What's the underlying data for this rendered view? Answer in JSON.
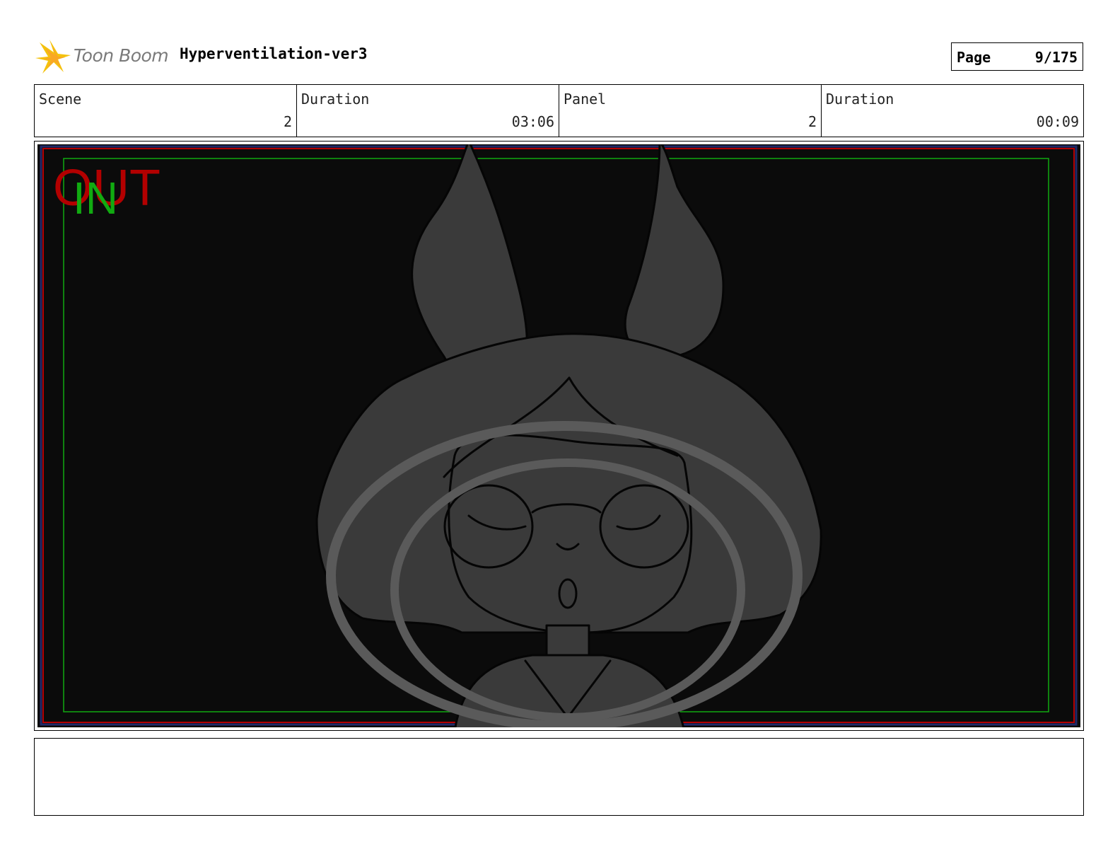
{
  "header": {
    "brand": "Toon Boom",
    "project_title": "Hyperventilation-ver3",
    "page_label": "Page",
    "page_value": "9/175"
  },
  "info": {
    "scene_label": "Scene",
    "scene_value": "2",
    "scene_duration_label": "Duration",
    "scene_duration_value": "03:06",
    "panel_label": "Panel",
    "panel_value": "2",
    "panel_duration_label": "Duration",
    "panel_duration_value": "00:09"
  },
  "frame": {
    "out_label": "OUT",
    "in_label": "IN",
    "background_color": "#0b0b0b",
    "out_frame_color": "#b30000",
    "in_frame_color": "#11aa11",
    "sketch_fill_color": "#3a3a3a",
    "breath_ring_color": "#5a5a5a"
  },
  "dialogue": {
    "text": ""
  }
}
